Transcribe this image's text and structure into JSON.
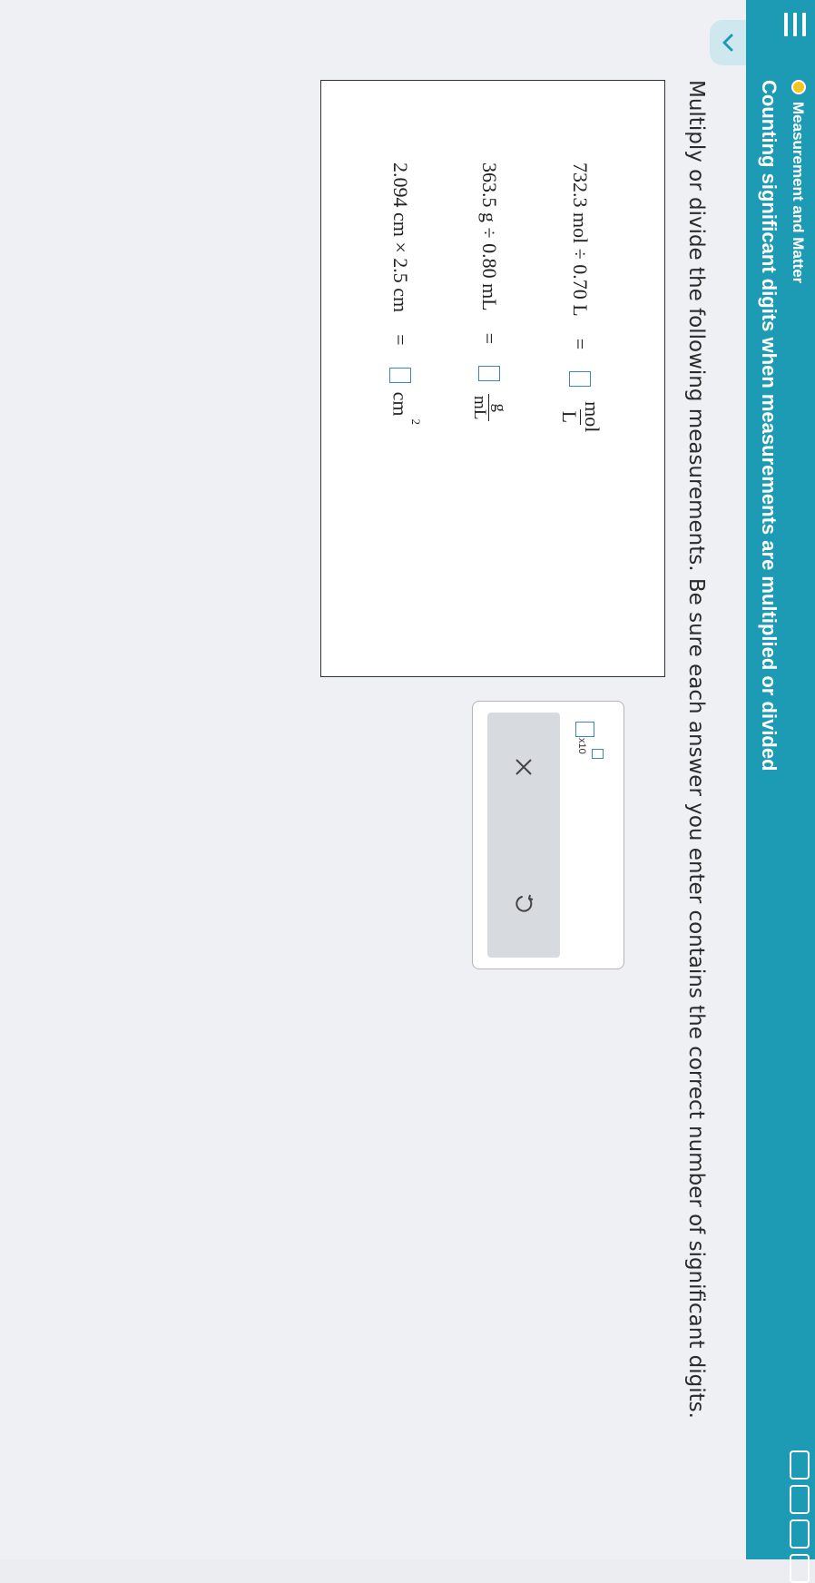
{
  "header": {
    "subject": "Measurement and Matter",
    "topic": "Counting significant digits when measurements are multiplied or divided",
    "status_color": "#f5c518",
    "bar_color": "#1d9bb4",
    "progress_segments": 4
  },
  "instructions": "Multiply or divide the following measurements. Be sure each answer you enter contains the correct number of significant digits.",
  "questions": [
    {
      "expression": "732.3 mol ÷ 0.70 L",
      "equals": "=",
      "unit_numerator": "mol",
      "unit_denominator": "L",
      "answer": ""
    },
    {
      "expression": "363.5 g ÷ 0.80 mL",
      "equals": "=",
      "unit_numerator": "g",
      "unit_denominator": "mL",
      "answer": ""
    },
    {
      "expression": "2.094 cm × 2.5 cm",
      "equals": "=",
      "unit": "cm",
      "unit_exponent": "2",
      "answer": ""
    }
  ],
  "keypad": {
    "sci_label": "x10",
    "clear_icon": "times-icon",
    "undo_icon": "undo-icon",
    "clear_symbol": "×",
    "undo_symbol": "↺"
  }
}
